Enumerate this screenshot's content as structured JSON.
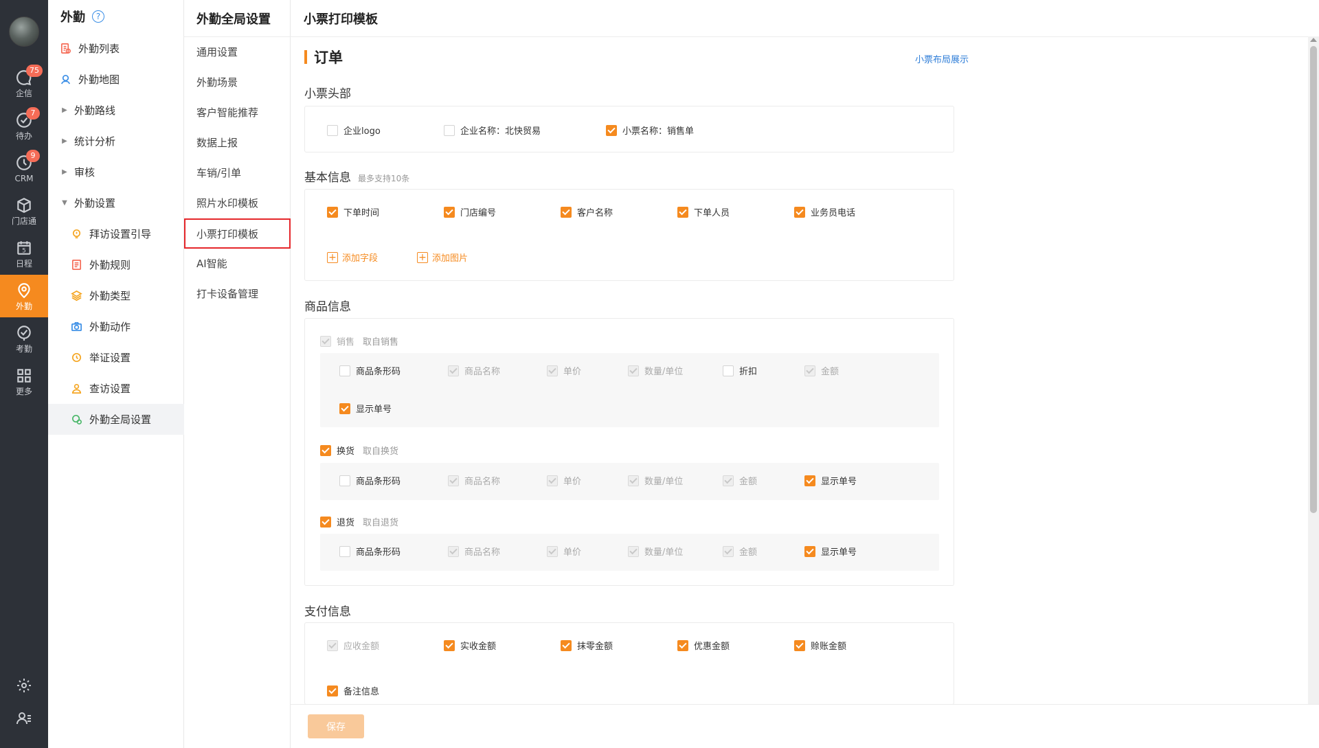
{
  "rail": {
    "items": [
      {
        "label": "企信",
        "badge": "75",
        "icon": "chat-icon"
      },
      {
        "label": "待办",
        "badge": "7",
        "icon": "check-circle-icon"
      },
      {
        "label": "CRM",
        "badge": "9",
        "icon": "clock-icon"
      },
      {
        "label": "门店通",
        "badge": "",
        "icon": "cube-icon"
      },
      {
        "label": "日程",
        "badge": "",
        "icon": "calendar-icon"
      },
      {
        "label": "外勤",
        "badge": "",
        "icon": "location-icon",
        "active": true
      },
      {
        "label": "考勤",
        "badge": "",
        "icon": "check-icon"
      },
      {
        "label": "更多",
        "badge": "",
        "icon": "grid-icon"
      }
    ],
    "bottom_icons": [
      "gear-icon",
      "user-list-icon"
    ]
  },
  "module": {
    "title": "外勤",
    "help_icon": "?",
    "items": [
      {
        "label": "外勤列表",
        "icon": "list-icon"
      },
      {
        "label": "外勤地图",
        "icon": "map-pin-icon"
      },
      {
        "label": "外勤路线",
        "icon": "caret-right-icon"
      },
      {
        "label": "统计分析",
        "icon": "caret-right-icon"
      },
      {
        "label": "审核",
        "icon": "caret-right-icon"
      },
      {
        "label": "外勤设置",
        "icon": "caret-down-icon"
      },
      {
        "label": "拜访设置引导",
        "icon": "bulb-icon"
      },
      {
        "label": "外勤规则",
        "icon": "doc-icon"
      },
      {
        "label": "外勤类型",
        "icon": "layers-icon"
      },
      {
        "label": "外勤动作",
        "icon": "camera-icon"
      },
      {
        "label": "举证设置",
        "icon": "clock-icon"
      },
      {
        "label": "查访设置",
        "icon": "person-icon"
      },
      {
        "label": "外勤全局设置",
        "icon": "global-icon",
        "selected": true
      }
    ]
  },
  "settings_nav": {
    "title": "外勤全局设置",
    "items": [
      "通用设置",
      "外勤场景",
      "客户智能推荐",
      "数据上报",
      "车销/引单",
      "照片水印模板",
      "小票打印模板",
      "AI智能",
      "打卡设备管理"
    ],
    "selected_index": 6
  },
  "page": {
    "title": "小票打印模板",
    "section": "订单",
    "layout_link": "小票布局展示",
    "header": {
      "title": "小票头部",
      "options": [
        {
          "label": "企业logo",
          "state": "off"
        },
        {
          "label": "企业名称：北快贸易",
          "state": "off"
        },
        {
          "label": "小票名称：销售单",
          "state": "on"
        }
      ]
    },
    "basic": {
      "title": "基本信息",
      "hint": "最多支持10条",
      "options": [
        {
          "label": "下单时间",
          "state": "on"
        },
        {
          "label": "门店编号",
          "state": "on"
        },
        {
          "label": "客户名称",
          "state": "on"
        },
        {
          "label": "下单人员",
          "state": "on"
        },
        {
          "label": "业务员电话",
          "state": "on"
        }
      ],
      "add_field": "添加字段",
      "add_image": "添加图片"
    },
    "goods": {
      "title": "商品信息",
      "groups": [
        {
          "label": "销售",
          "sub": "取自销售",
          "state": "dis",
          "fields": [
            {
              "label": "商品条形码",
              "state": "off"
            },
            {
              "label": "商品名称",
              "state": "dis"
            },
            {
              "label": "单价",
              "state": "dis"
            },
            {
              "label": "数量/单位",
              "state": "dis"
            },
            {
              "label": "折扣",
              "state": "off"
            },
            {
              "label": "金额",
              "state": "dis"
            },
            {
              "label": "显示单号",
              "state": "on"
            }
          ]
        },
        {
          "label": "换货",
          "sub": "取自换货",
          "state": "on",
          "fields": [
            {
              "label": "商品条形码",
              "state": "off"
            },
            {
              "label": "商品名称",
              "state": "dis"
            },
            {
              "label": "单价",
              "state": "dis"
            },
            {
              "label": "数量/单位",
              "state": "dis"
            },
            {
              "label": "金额",
              "state": "dis"
            },
            {
              "label": "显示单号",
              "state": "on"
            }
          ]
        },
        {
          "label": "退货",
          "sub": "取自退货",
          "state": "on",
          "fields": [
            {
              "label": "商品条形码",
              "state": "off"
            },
            {
              "label": "商品名称",
              "state": "dis"
            },
            {
              "label": "单价",
              "state": "dis"
            },
            {
              "label": "数量/单位",
              "state": "dis"
            },
            {
              "label": "金额",
              "state": "dis"
            },
            {
              "label": "显示单号",
              "state": "on"
            }
          ]
        }
      ]
    },
    "payment": {
      "title": "支付信息",
      "options": [
        {
          "label": "应收金额",
          "state": "dis"
        },
        {
          "label": "实收金额",
          "state": "on"
        },
        {
          "label": "抹零金额",
          "state": "on"
        },
        {
          "label": "优惠金额",
          "state": "on"
        },
        {
          "label": "赊账金额",
          "state": "on"
        },
        {
          "label": "备注信息",
          "state": "on"
        }
      ]
    },
    "save_label": "保存"
  },
  "colors": {
    "accent": "#f58a1f",
    "rail_bg": "#2d3138",
    "link": "#2f7ed8",
    "badge": "#f56c57",
    "highlight_border": "#e5262a"
  }
}
